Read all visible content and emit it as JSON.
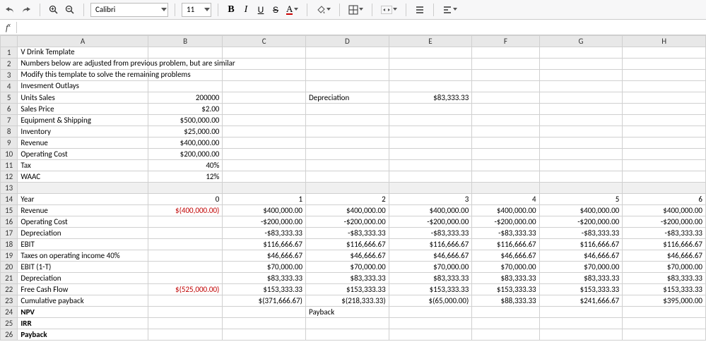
{
  "toolbar": {
    "font": "Calibri",
    "size": "11",
    "bold": "B",
    "italic": "I",
    "underline": "U",
    "strike": "S",
    "fontcolor": "A"
  },
  "formula": {
    "fx": "f",
    "value": ""
  },
  "colHeaders": [
    "A",
    "B",
    "C",
    "D",
    "E",
    "F",
    "G",
    "H"
  ],
  "rows": [
    {
      "n": "1",
      "A": "V Drink Template",
      "over": true
    },
    {
      "n": "2",
      "A": "Numbers below are adjusted from previous problem, but are similar",
      "over": true
    },
    {
      "n": "3",
      "A": "Modify this template to solve the remaining problems",
      "over": true
    },
    {
      "n": "4",
      "A": "Invesment Outlays",
      "over": true
    },
    {
      "n": "5",
      "A": "Units Sales",
      "B": "200000",
      "D": "Depreciation",
      "Dleft": true,
      "E": "$83,333.33"
    },
    {
      "n": "6",
      "A": "Sales Price",
      "B": "$2.00"
    },
    {
      "n": "7",
      "A": "Equipment & Shipping",
      "B": "$500,000.00"
    },
    {
      "n": "8",
      "A": "Inventory",
      "B": "$25,000.00"
    },
    {
      "n": "9",
      "A": "Revenue",
      "B": "$400,000.00"
    },
    {
      "n": "10",
      "A": "Operating Cost",
      "B": "$200,000.00"
    },
    {
      "n": "11",
      "A": "Tax",
      "B": "40%"
    },
    {
      "n": "12",
      "A": "WAAC",
      "B": "12%"
    },
    {
      "n": "13",
      "shaded": true
    },
    {
      "n": "14",
      "A": "Year",
      "B": "0",
      "C": "1",
      "D": "2",
      "E": "3",
      "F": "4",
      "G": "5",
      "H": "6"
    },
    {
      "n": "15",
      "A": "Revenue",
      "B": "$(400,000.00)",
      "Bneg": true,
      "C": "$400,000.00",
      "D": "$400,000.00",
      "E": "$400,000.00",
      "F": "$400,000.00",
      "G": "$400,000.00",
      "H": "$400,000.00"
    },
    {
      "n": "16",
      "A": "Operating Cost",
      "C": "-$200,000.00",
      "D": "-$200,000.00",
      "E": "-$200,000.00",
      "F": "-$200,000.00",
      "G": "-$200,000.00",
      "H": "-$200,000.00"
    },
    {
      "n": "17",
      "A": "Depreciation",
      "C": "-$83,333.33",
      "D": "-$83,333.33",
      "E": "-$83,333.33",
      "F": "-$83,333.33",
      "G": "-$83,333.33",
      "H": "-$83,333.33"
    },
    {
      "n": "18",
      "A": "EBIT",
      "C": "$116,666.67",
      "D": "$116,666.67",
      "E": "$116,666.67",
      "F": "$116,666.67",
      "G": "$116,666.67",
      "H": "$116,666.67"
    },
    {
      "n": "19",
      "A": "Taxes on operating income 40%",
      "C": "$46,666.67",
      "D": "$46,666.67",
      "E": "$46,666.67",
      "F": "$46,666.67",
      "G": "$46,666.67",
      "H": "$46,666.67"
    },
    {
      "n": "20",
      "A": "EBIT (1-T)",
      "C": "$70,000.00",
      "D": "$70,000.00",
      "E": "$70,000.00",
      "F": "$70,000.00",
      "G": "$70,000.00",
      "H": "$70,000.00"
    },
    {
      "n": "21",
      "A": "Depreciation",
      "C": "$83,333.33",
      "D": "$83,333.33",
      "E": "$83,333.33",
      "F": "$83,333.33",
      "G": "$83,333.33",
      "H": "$83,333.33"
    },
    {
      "n": "22",
      "A": "Free Cash Flow",
      "B": "$(525,000.00)",
      "Bneg": true,
      "C": "$153,333.33",
      "D": "$153,333.33",
      "E": "$153,333.33",
      "F": "$153,333.33",
      "G": "$153,333.33",
      "H": "$153,333.33"
    },
    {
      "n": "23",
      "A": "Cumulative payback",
      "C": "$(371,666.67)",
      "D": "$(218,333.33)",
      "E": "$(65,000.00)",
      "F": "$88,333.33",
      "G": "$241,666.67",
      "H": "$395,000.00"
    },
    {
      "n": "24",
      "A": "NPV",
      "Abold": true,
      "D": "Payback",
      "Dleft": true
    },
    {
      "n": "25",
      "A": "IRR",
      "Abold": true
    },
    {
      "n": "26",
      "A": "Payback",
      "Abold": true
    }
  ]
}
